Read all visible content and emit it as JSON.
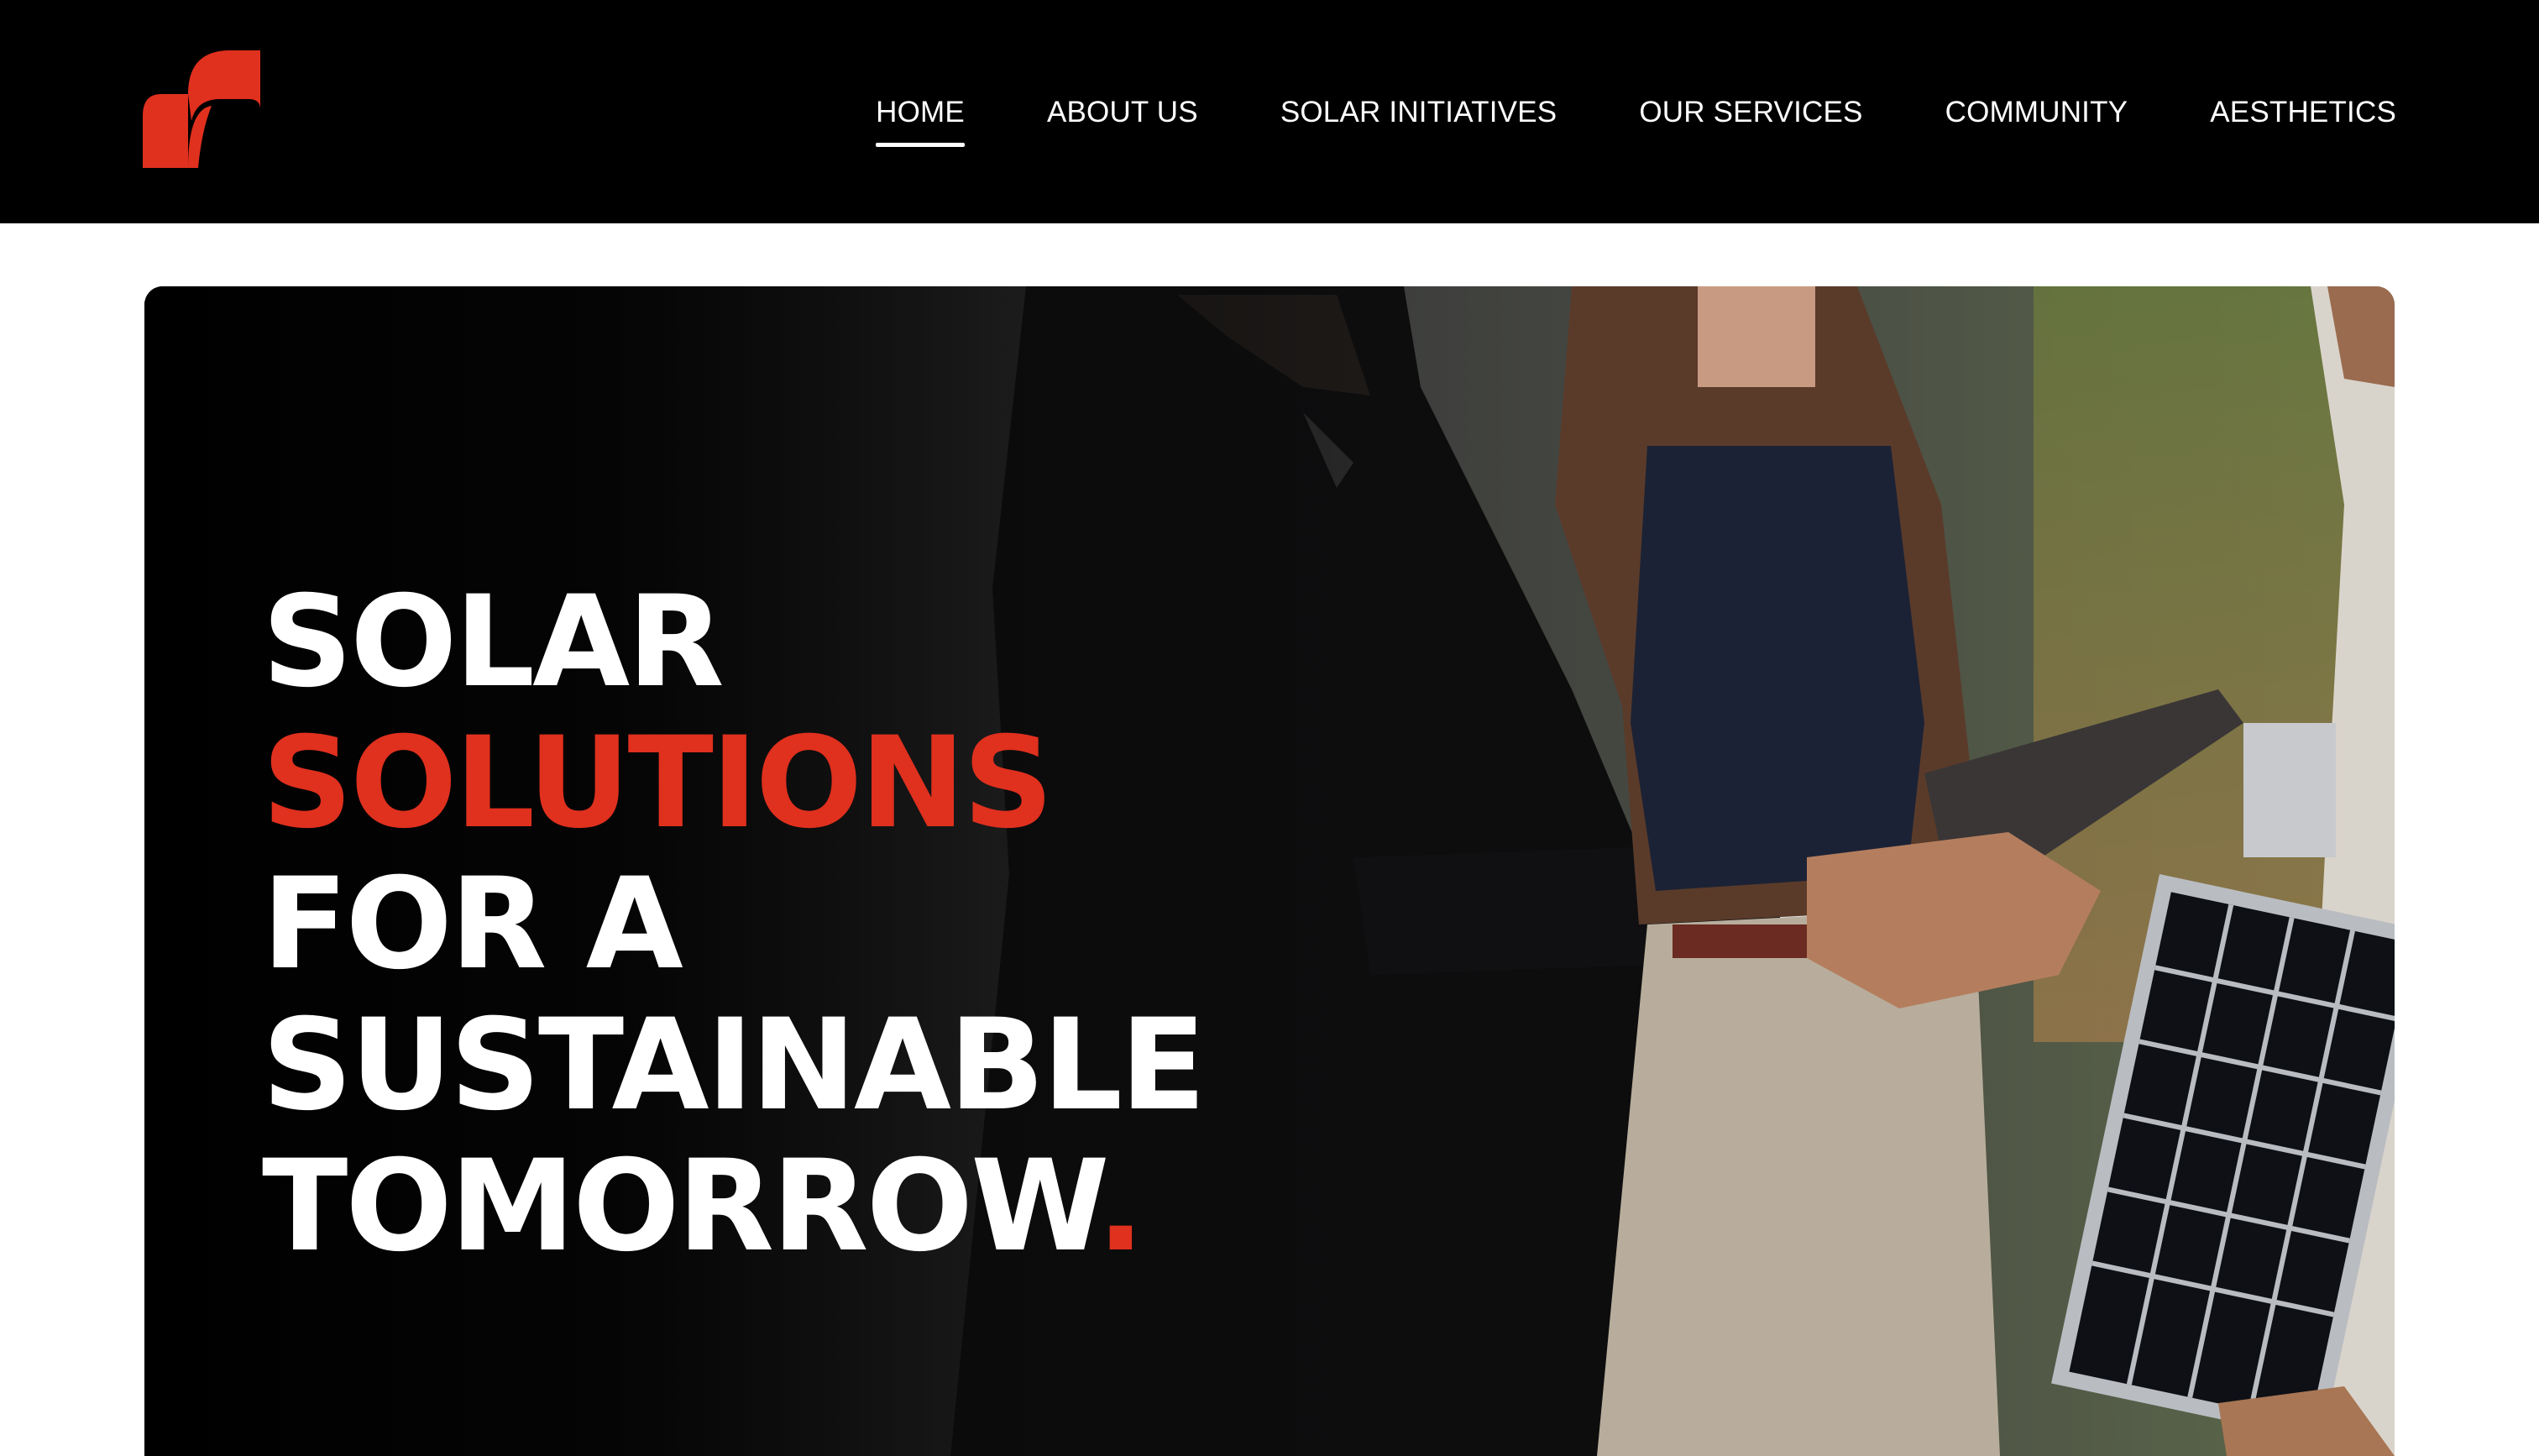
{
  "brand": {
    "logo_icon": "brand-logo-icon",
    "accent_color": "#e0301e"
  },
  "nav": {
    "items": [
      {
        "label": "HOME",
        "active": true
      },
      {
        "label": "ABOUT US",
        "active": false
      },
      {
        "label": "SOLAR INITIATIVES",
        "active": false
      },
      {
        "label": "OUR SERVICES",
        "active": false
      },
      {
        "label": "COMMUNITY",
        "active": false
      },
      {
        "label": "AESTHETICS",
        "active": false
      }
    ]
  },
  "hero": {
    "headline": {
      "line1": "SOLAR",
      "line2": "SOLUTIONS",
      "line3": "FOR A",
      "line4": "SUSTAINABLE",
      "line5": "TOMORROW",
      "period": "."
    },
    "image_icon": "business-handshake-solar-panel-photo"
  },
  "colors": {
    "header_bg": "#000000",
    "text": "#ffffff",
    "accent": "#e0301e"
  }
}
